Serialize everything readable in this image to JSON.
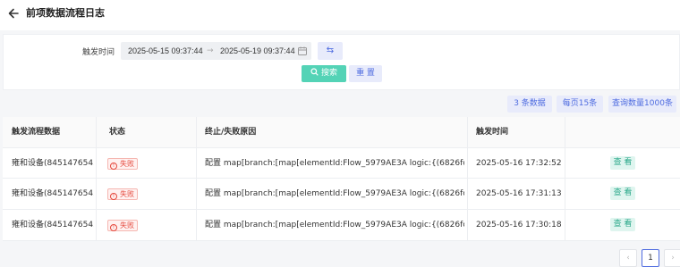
{
  "header": {
    "title": "前项数据流程日志",
    "back_icon": "arrow-left-icon"
  },
  "filter": {
    "label": "触发时间",
    "start": "2025-05-15 09:37:44",
    "separator": "→",
    "end": "2025-05-19 09:37:44",
    "swap_symbol": "⇆",
    "search_label": "搜索",
    "reset_label": "重 置"
  },
  "summary": {
    "count": "3 条数据",
    "page_size": "每页15条",
    "query_limit": "查询数量1000条"
  },
  "table": {
    "columns": [
      "触发流程数据",
      "状态",
      "终止/失败原因",
      "触发时间",
      ""
    ],
    "rows": [
      {
        "data": "雍和设备(845147654...",
        "status": "失败",
        "reason": "配置 map[branch:[map[elementId:Flow_5979AE3A logic:{(6826fc5d44789...",
        "time": "2025-05-16 17:32:52",
        "action": "查 看"
      },
      {
        "data": "雍和设备(845147654...",
        "status": "失败",
        "reason": "配置 map[branch:[map[elementId:Flow_5979AE3A logic:{(6826fc5d44789...",
        "time": "2025-05-16 17:31:13",
        "action": "查 看"
      },
      {
        "data": "雍和设备(845147654...",
        "status": "失败",
        "reason": "配置 map[branch:[map[elementId:Flow_5979AE3A logic:{(6826fc5d44789...",
        "time": "2025-05-16 17:30:18",
        "action": "查 看"
      }
    ]
  },
  "pagination": {
    "prev": "‹",
    "current": "1",
    "next": "›"
  },
  "colors": {
    "accent": "#4f6ce0",
    "search_green": "#54d3b6",
    "fail_red": "#e5483c"
  }
}
